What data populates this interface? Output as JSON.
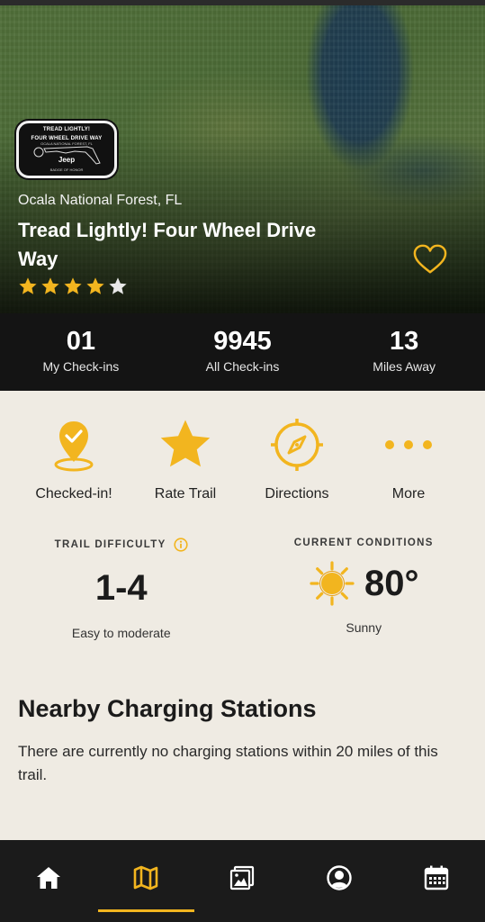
{
  "colors": {
    "accent": "#f2b51f",
    "dark": "#141414",
    "background": "#efebe3"
  },
  "hero": {
    "badge": {
      "title_line1": "TREAD LIGHTLY!",
      "title_line2": "FOUR WHEEL DRIVE WAY",
      "subtitle": "OCALA NATIONAL FOREST, FL",
      "brand": "Jeep",
      "caption": "BADGE OF HONOR"
    },
    "location": "Ocala National Forest, FL",
    "title": "Tread Lightly! Four Wheel Drive Way",
    "rating": 4,
    "rating_max": 5,
    "favorite_icon": "heart-icon"
  },
  "stats": [
    {
      "value": "01",
      "label": "My Check-ins"
    },
    {
      "value": "9945",
      "label": "All Check-ins"
    },
    {
      "value": "13",
      "label": "Miles Away"
    }
  ],
  "actions": [
    {
      "label": "Checked-in!",
      "icon": "checkin-pin-icon"
    },
    {
      "label": "Rate Trail",
      "icon": "star-icon"
    },
    {
      "label": "Directions",
      "icon": "compass-icon"
    },
    {
      "label": "More",
      "icon": "more-dots-icon"
    }
  ],
  "difficulty": {
    "heading": "TRAIL DIFFICULTY",
    "value": "1-4",
    "description": "Easy to moderate"
  },
  "conditions": {
    "heading": "CURRENT CONDITIONS",
    "temperature": "80°",
    "description": "Sunny",
    "icon": "sun-icon"
  },
  "charging": {
    "title": "Nearby Charging Stations",
    "text": "There are currently no charging stations within 20 miles of this trail."
  },
  "nav": [
    {
      "icon": "home-icon",
      "active": false
    },
    {
      "icon": "map-icon",
      "active": true
    },
    {
      "icon": "gallery-icon",
      "active": false
    },
    {
      "icon": "profile-icon",
      "active": false
    },
    {
      "icon": "calendar-icon",
      "active": false
    }
  ]
}
